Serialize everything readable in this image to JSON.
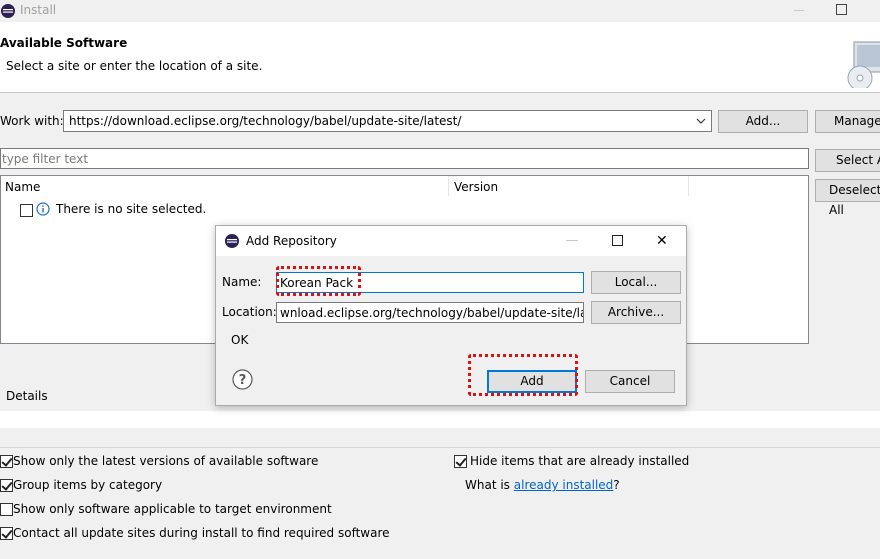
{
  "window": {
    "title": "Install",
    "header_title": "Available Software",
    "header_desc": "Select a site or enter the location of a site."
  },
  "work_with": {
    "label": "Work with:",
    "value": "https://download.eclipse.org/technology/babel/update-site/latest/",
    "add_label": "Add...",
    "manage_label": "Manage..."
  },
  "filter": {
    "placeholder": "type filter text",
    "select_all_label": "Select All",
    "deselect_all_label": "Deselect All"
  },
  "tree": {
    "columns": [
      "Name",
      "Version"
    ],
    "empty_row": "There is no site selected."
  },
  "details": {
    "label": "Details"
  },
  "options": {
    "latest_only": "Show only the latest versions of available software",
    "group_by_category": "Group items by category",
    "applicable_only": "Show only software applicable to target environment",
    "contact_all": "Contact all update sites during install to find required software",
    "hide_installed": "Hide items that are already installed",
    "what_is_prefix": "What is ",
    "what_is_link": "already installed",
    "what_is_suffix": "?"
  },
  "dialog": {
    "title": "Add Repository",
    "name_label": "Name:",
    "name_value": "Korean Pack",
    "local_label": "Local...",
    "location_label": "Location:",
    "location_value": "wnload.eclipse.org/technology/babel/update-site/latest/",
    "archive_label": "Archive...",
    "status": "OK",
    "add_label": "Add",
    "cancel_label": "Cancel"
  }
}
